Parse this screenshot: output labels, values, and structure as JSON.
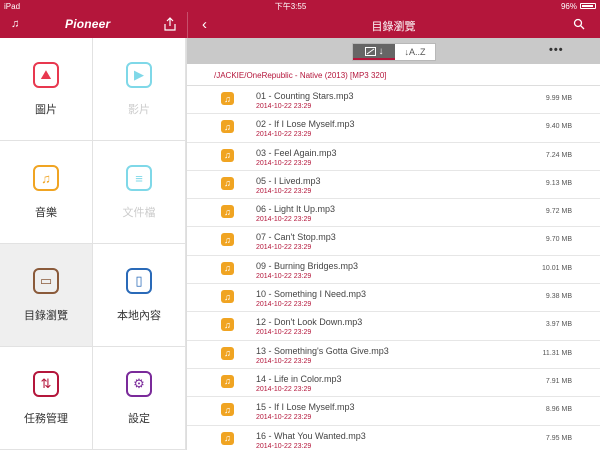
{
  "status": {
    "device": "iPad",
    "time": "下午3:55",
    "battery": "96%"
  },
  "header": {
    "logo": "Pioneer",
    "title": "目錄瀏覽"
  },
  "toolbar": {
    "sort_az": "↓A..Z",
    "sort_date_arrow": "↓"
  },
  "path": "/JACKIE/OneRepublic - Native (2013) [MP3 320]",
  "menu": [
    {
      "label": "圖片",
      "icon": "picture-icon",
      "color": "#e8384f",
      "enabled": true,
      "active": false
    },
    {
      "label": "影片",
      "icon": "video-icon",
      "color": "#7fd8e8",
      "enabled": false,
      "active": false
    },
    {
      "label": "音樂",
      "icon": "music-icon",
      "color": "#f0a422",
      "enabled": true,
      "active": false
    },
    {
      "label": "文件檔",
      "icon": "document-icon",
      "color": "#7fd8e8",
      "enabled": false,
      "active": false
    },
    {
      "label": "目錄瀏覽",
      "icon": "folder-icon",
      "color": "#8a5a3a",
      "enabled": true,
      "active": true
    },
    {
      "label": "本地內容",
      "icon": "device-icon",
      "color": "#2a6ab8",
      "enabled": true,
      "active": false
    },
    {
      "label": "任務管理",
      "icon": "task-icon",
      "color": "#b4163b",
      "enabled": true,
      "active": false
    },
    {
      "label": "設定",
      "icon": "gear-icon",
      "color": "#7a2a9a",
      "enabled": true,
      "active": false
    }
  ],
  "files": [
    {
      "name": "01 - Counting Stars.mp3",
      "date": "2014-10-22 23:29",
      "size": "9.99 MB"
    },
    {
      "name": "02 - If I Lose Myself.mp3",
      "date": "2014-10-22 23:29",
      "size": "9.40 MB"
    },
    {
      "name": "03 - Feel Again.mp3",
      "date": "2014-10-22 23:29",
      "size": "7.24 MB"
    },
    {
      "name": "05 - I Lived.mp3",
      "date": "2014-10-22 23:29",
      "size": "9.13 MB"
    },
    {
      "name": "06 - Light It Up.mp3",
      "date": "2014-10-22 23:29",
      "size": "9.72 MB"
    },
    {
      "name": "07 - Can't Stop.mp3",
      "date": "2014-10-22 23:29",
      "size": "9.70 MB"
    },
    {
      "name": "09 - Burning Bridges.mp3",
      "date": "2014-10-22 23:29",
      "size": "10.01 MB"
    },
    {
      "name": "10 - Something I Need.mp3",
      "date": "2014-10-22 23:29",
      "size": "9.38 MB"
    },
    {
      "name": "12 - Don't Look Down.mp3",
      "date": "2014-10-22 23:29",
      "size": "3.97 MB"
    },
    {
      "name": "13 - Something's Gotta Give.mp3",
      "date": "2014-10-22 23:29",
      "size": "11.31 MB"
    },
    {
      "name": "14 - Life in Color.mp3",
      "date": "2014-10-22 23:29",
      "size": "7.91 MB"
    },
    {
      "name": "15 - If I Lose Myself.mp3",
      "date": "2014-10-22 23:29",
      "size": "8.96 MB"
    },
    {
      "name": "16 - What You Wanted.mp3",
      "date": "2014-10-22 23:29",
      "size": "7.95 MB"
    }
  ]
}
